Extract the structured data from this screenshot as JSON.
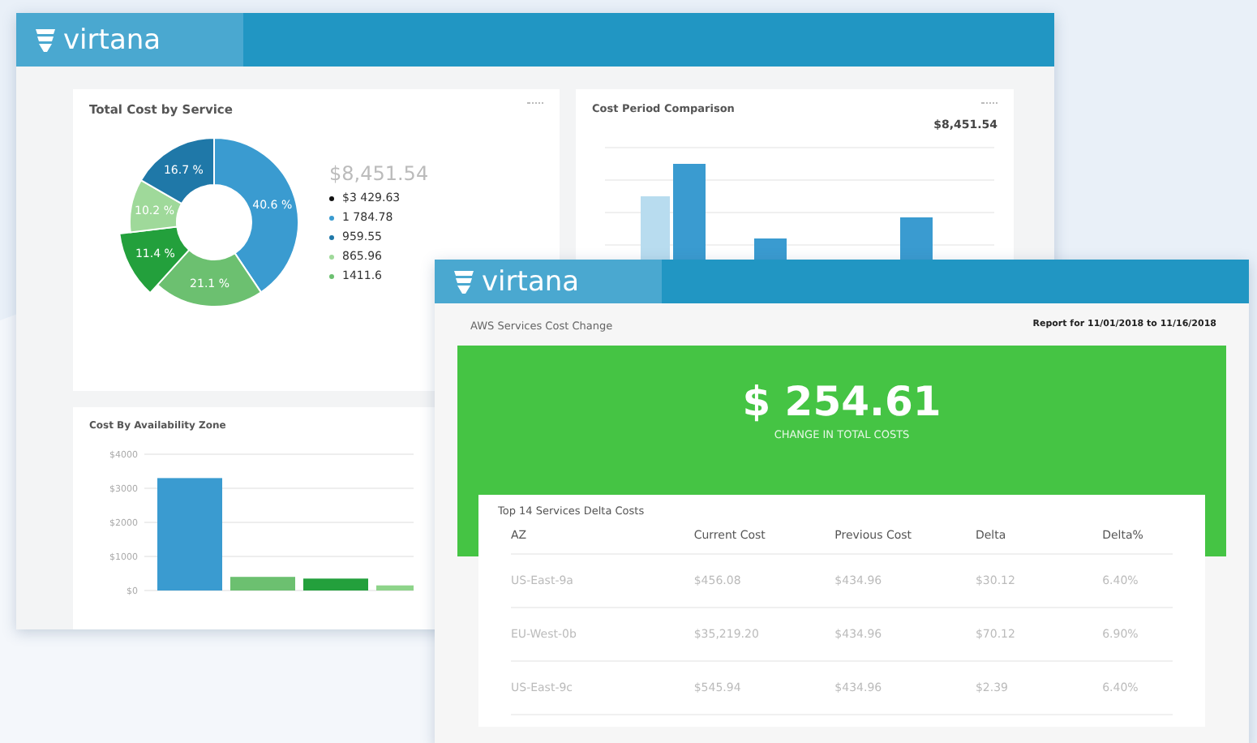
{
  "back_window": {
    "logo": "virtana",
    "total_cost_card": {
      "title": "Total Cost by Service",
      "total": "$8,451.54",
      "legend": [
        {
          "value": "$3 429.63",
          "color": "#111111"
        },
        {
          "value": "1 784.78",
          "color": "#3a9bd0"
        },
        {
          "value": "959.55",
          "color": "#1f78a8"
        },
        {
          "value": "865.96",
          "color": "#9fd99a"
        },
        {
          "value": "1411.6",
          "color": "#6cc070"
        }
      ],
      "chart_data": {
        "type": "donut",
        "values": [
          40.6,
          21.1,
          11.4,
          10.2,
          16.7
        ],
        "value_labels": [
          "40.6 %",
          "21.1 %",
          "11.4 %",
          "10.2 %",
          "16.7 %"
        ]
      }
    },
    "period_card": {
      "title": "Cost Period Comparison",
      "total": "$8,451.54"
    },
    "zone_card": {
      "title": "Cost By Availability Zone",
      "chart_data": {
        "type": "bar",
        "ylim": [
          0,
          4000
        ],
        "yticks": [
          {
            "value": 4000,
            "label": "$4000"
          },
          {
            "value": 3000,
            "label": "$3000"
          },
          {
            "value": 2000,
            "label": "$2000"
          },
          {
            "value": 1000,
            "label": "$1000"
          },
          {
            "value": 0,
            "label": "$0"
          }
        ],
        "grid": true,
        "values": [
          3300,
          400,
          350,
          150
        ]
      }
    }
  },
  "front_window": {
    "logo": "virtana",
    "title": "AWS Services Cost Change",
    "report_range": "Report for 11/01/2018 to 11/16/2018",
    "amount": "$ 254.61",
    "amount_caption": "CHANGE IN TOTAL COSTS",
    "table": {
      "title": "Top 14 Services Delta Costs",
      "columns": [
        "AZ",
        "Current Cost",
        "Previous Cost",
        "Delta",
        "Delta%"
      ],
      "rows": [
        [
          "US-East-9a",
          "$456.08",
          "$434.96",
          "$30.12",
          "6.40%"
        ],
        [
          "EU-West-0b",
          "$35,219.20",
          "$434.96",
          "$70.12",
          "6.90%"
        ],
        [
          "US-East-9c",
          "$545.94",
          "$434.96",
          "$2.39",
          "6.40%"
        ]
      ]
    }
  }
}
